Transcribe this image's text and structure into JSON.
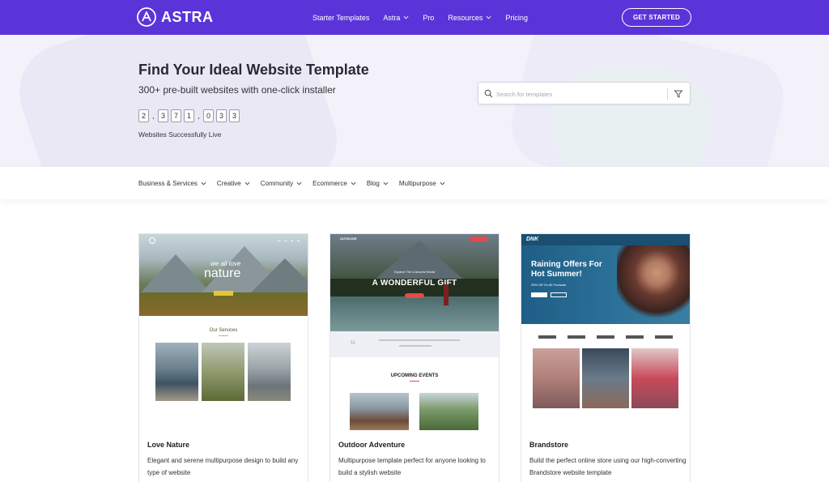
{
  "header": {
    "logo_text": "ASTRA",
    "nav": [
      {
        "label": "Starter Templates",
        "dropdown": false
      },
      {
        "label": "Astra",
        "dropdown": true
      },
      {
        "label": "Pro",
        "dropdown": false
      },
      {
        "label": "Resources",
        "dropdown": true
      },
      {
        "label": "Pricing",
        "dropdown": false
      }
    ],
    "cta_label": "GET STARTED",
    "bg_color": "#5b34d9"
  },
  "hero": {
    "title": "Find Your Ideal Website Template",
    "subtitle": "300+ pre-built websites with one-click installer",
    "counter": [
      "2",
      ",",
      "3",
      "7",
      "1",
      ",",
      "0",
      "3",
      "3"
    ],
    "counter_label": "Websites Successfully Live",
    "search_placeholder": "Search for templates"
  },
  "categories": [
    "Business & Services",
    "Creative",
    "Community",
    "Ecommerce",
    "Blog",
    "Multipurpose"
  ],
  "templates": [
    {
      "title": "Love Nature",
      "description": "Elegant and serene multipurpose design to build any type of website",
      "preview": {
        "hero_small": "we all love",
        "hero_big": "nature",
        "section": "Our Services"
      }
    },
    {
      "title": "Outdoor Adventure",
      "description": "Multipurpose template perfect for anyone looking to build a stylish website",
      "preview": {
        "brand": "OUTDOOR",
        "hero_small": "Explore The Colourful World",
        "hero_big": "A WONDERFUL GIFT",
        "section": "UPCOMING EVENTS"
      }
    },
    {
      "title": "Brandstore",
      "description": "Build the perfect online store using our high-converting Brandstore website template",
      "preview": {
        "brand": "DNK",
        "hero_big": "Raining Offers For Hot Summer!",
        "hero_small": "25% Off On All Products"
      }
    }
  ]
}
